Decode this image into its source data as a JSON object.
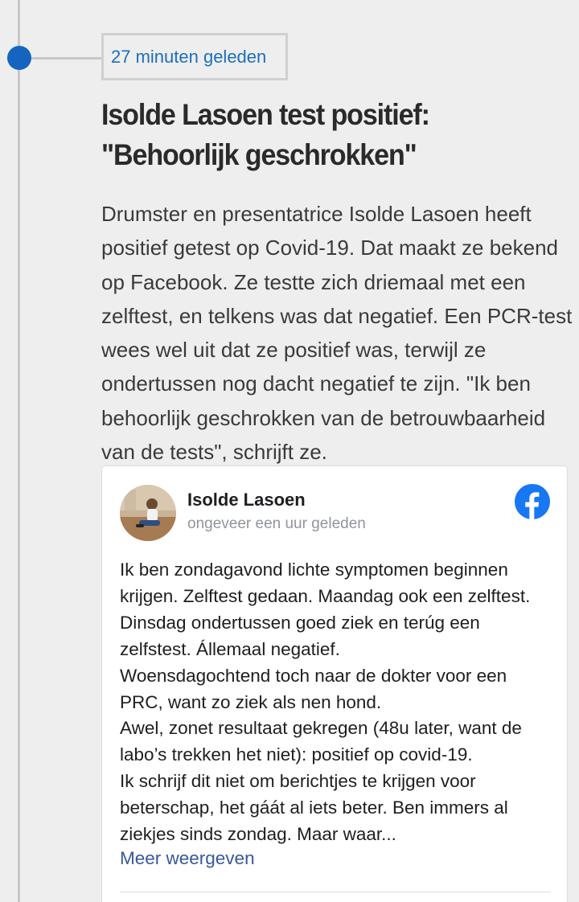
{
  "entry": {
    "time_ago": "27 minuten geleden",
    "headline_line1": "Isolde Lasoen test positief:",
    "headline_line2": "\"Behoorlijk geschrokken\"",
    "body": "Drumster en presentatrice Isolde Lasoen heeft positief getest op Covid-19. Dat maakt ze bekend op Facebook. Ze testte zich driemaal met een zelftest, en telkens was dat negatief. Een PCR-test wees wel uit dat ze positief was, terwijl ze ondertussen nog dacht negatief te zijn. \"Ik ben behoorlijk geschrokken van de betrouwbaarheid van de tests\", schrijft ze."
  },
  "facebook_post": {
    "author": "Isolde Lasoen",
    "time": "ongeveer een uur geleden",
    "icon": "facebook-icon",
    "text": "Ik ben zondagavond lichte symptomen beginnen krijgen. Zelftest gedaan. Maandag ook een zelftest. Dinsdag ondertussen goed ziek en terúg een zelfstest. Állemaal negatief.\nWoensdagochtend toch naar de dokter voor een PRC, want zo ziek als nen hond.\nAwel, zonet resultaat gekregen (48u later, want de labo’s trekken het niet): positief op covid-19.\nIk schrijf dit niet om berichtjes te krijgen voor beterschap, het gáát al iets beter. Ben immers al ziekjes sinds zondag. Maar waar...",
    "see_more": "Meer weergeven"
  },
  "colors": {
    "timeline_dot": "#1565c0",
    "time_link": "#1a6fc0",
    "facebook_blue": "#1877f2",
    "see_more_link": "#385898"
  }
}
